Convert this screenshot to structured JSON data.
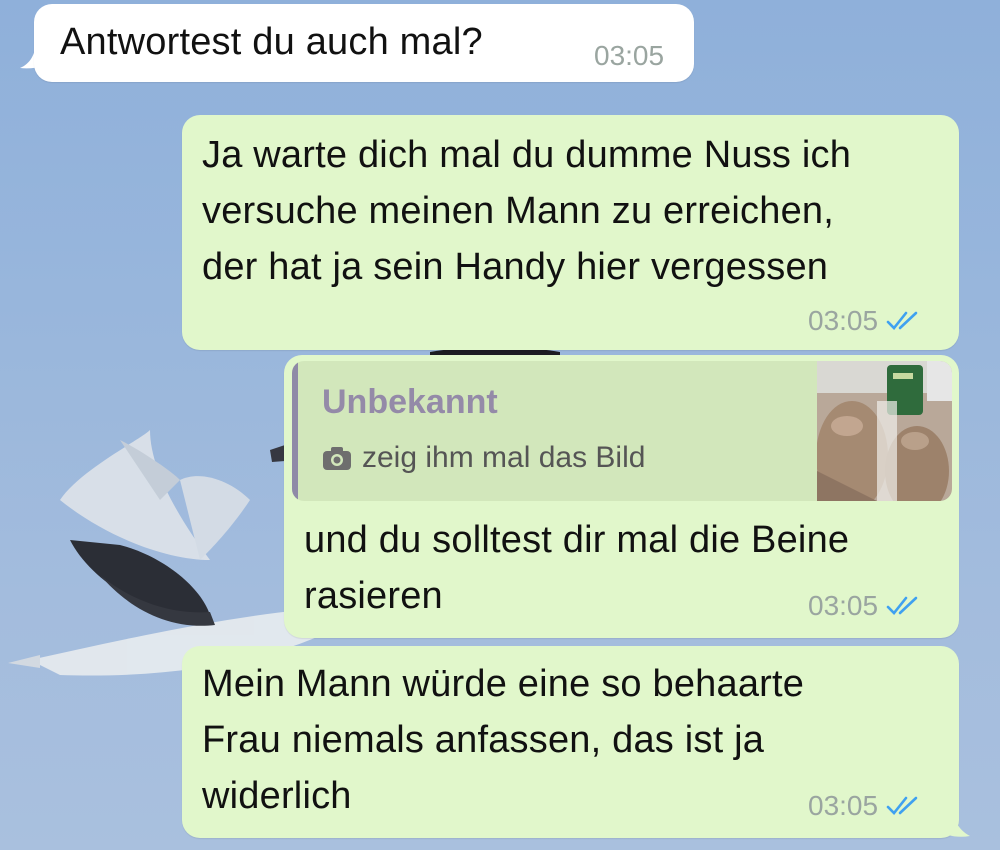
{
  "chat": {
    "messages": [
      {
        "direction": "incoming",
        "text": "Antwortest du auch mal?",
        "time": "03:05"
      },
      {
        "direction": "outgoing",
        "lines": [
          "Ja warte dich mal du dumme Nuss ich",
          "versuche meinen Mann zu erreichen,",
          "der hat ja sein Handy hier vergessen"
        ],
        "time": "03:05",
        "status": "read"
      },
      {
        "direction": "outgoing",
        "reply": {
          "author": "Unbekannt",
          "icon": "camera-icon",
          "text": "zeig ihm mal das Bild",
          "thumbnail": "photo-thumbnail"
        },
        "lines": [
          "und du solltest dir mal die Beine",
          "rasieren"
        ],
        "time": "03:05",
        "status": "read"
      },
      {
        "direction": "outgoing",
        "lines": [
          "Mein Mann würde eine so behaarte",
          "Frau niemals anfassen, das ist ja",
          "widerlich"
        ],
        "time": "03:05",
        "status": "read"
      }
    ]
  },
  "colors": {
    "incoming_bubble": "#ffffff",
    "outgoing_bubble": "#e1f7cb",
    "read_ticks": "#3fa1f0",
    "quote_author": "#948aa8",
    "wallpaper_sky": "#98b6dc"
  }
}
